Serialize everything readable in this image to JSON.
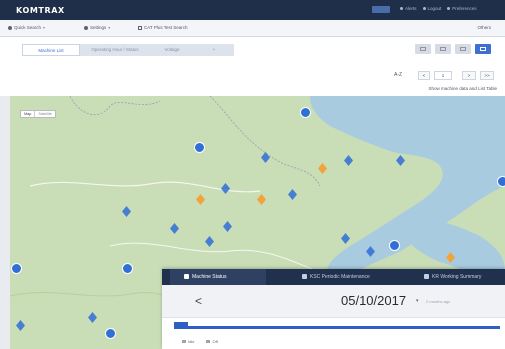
{
  "app": {
    "title": "KOMTRAX",
    "top_links": [
      "Alerts",
      "Logout",
      "Preferences"
    ]
  },
  "filters": {
    "search_label": "Quick Search",
    "settings_label": "Settings",
    "saved_label": "CAT Plus Test Search",
    "others_label": "Others"
  },
  "tabs": {
    "items": [
      "Machine List",
      "Operating Hour / Status",
      "Voltage",
      "+"
    ],
    "active": 0
  },
  "pager": {
    "sort_label": "A-Z",
    "prev": "<",
    "page": "1",
    "next": ">",
    "last": ">>"
  },
  "map_link": "Show machine data and List  Table",
  "map": {
    "map_type": "Map",
    "satellite_type": "Satellite"
  },
  "panel": {
    "tabs": [
      "Machine Status",
      "KSC Periodic Maintenance",
      "KR Working Summary"
    ],
    "date_prev": "<",
    "date": "05/10/2017",
    "date_caret": "▾",
    "date_sub": "2 months ago",
    "progress": 1.0,
    "legend": [
      "Idle",
      "Off"
    ]
  },
  "colors": {
    "header": "#1f2f49",
    "accent": "#3e6fd1",
    "marker_blue": "#2f6fd6",
    "marker_orange": "#f0a43a",
    "map_land": "#c9ddb7",
    "map_water": "#9fc7df"
  },
  "icons": [
    "search-icon",
    "gear-icon",
    "folder-icon",
    "grid-icon",
    "list-icon",
    "machine-marker-icon",
    "cluster-marker-icon"
  ]
}
